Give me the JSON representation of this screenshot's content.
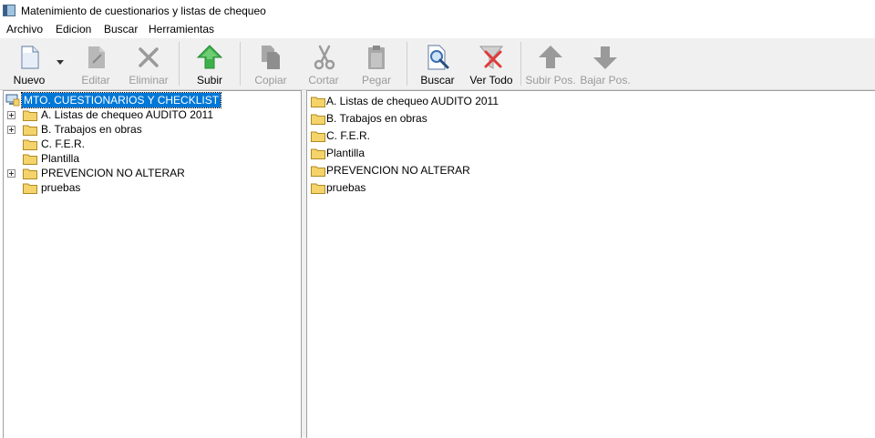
{
  "window": {
    "title": "Matenimiento de cuestionarios y listas de chequeo"
  },
  "menu": [
    "Archivo",
    "Edicion",
    "Buscar",
    "Herramientas"
  ],
  "toolbar": {
    "nuevo": "Nuevo",
    "editar": "Editar",
    "eliminar": "Eliminar",
    "subir": "Subir",
    "copiar": "Copiar",
    "cortar": "Cortar",
    "pegar": "Pegar",
    "buscar": "Buscar",
    "ver_todo": "Ver Todo",
    "subir_pos": "Subir Pos.",
    "bajar_pos": "Bajar Pos."
  },
  "tree": {
    "root": "MTO. CUESTIONARIOS Y CHECKLIST",
    "items": [
      {
        "label": "A. Listas de chequeo AUDITO 2011",
        "expandable": true
      },
      {
        "label": "B. Trabajos en obras",
        "expandable": true
      },
      {
        "label": "C. F.E.R.",
        "expandable": false
      },
      {
        "label": "Plantilla",
        "expandable": false
      },
      {
        "label": "PREVENCION NO ALTERAR",
        "expandable": true
      },
      {
        "label": "pruebas",
        "expandable": false
      }
    ]
  },
  "list": {
    "items": [
      "A. Listas de chequeo AUDITO 2011",
      "B. Trabajos en obras",
      "C. F.E.R.",
      "Plantilla",
      "PREVENCION NO ALTERAR",
      "pruebas"
    ]
  },
  "colors": {
    "selection": "#0078d7",
    "folder": "#f5d36b",
    "subir_green": "#3cb04a",
    "ver_todo_red": "#e03a3a"
  }
}
